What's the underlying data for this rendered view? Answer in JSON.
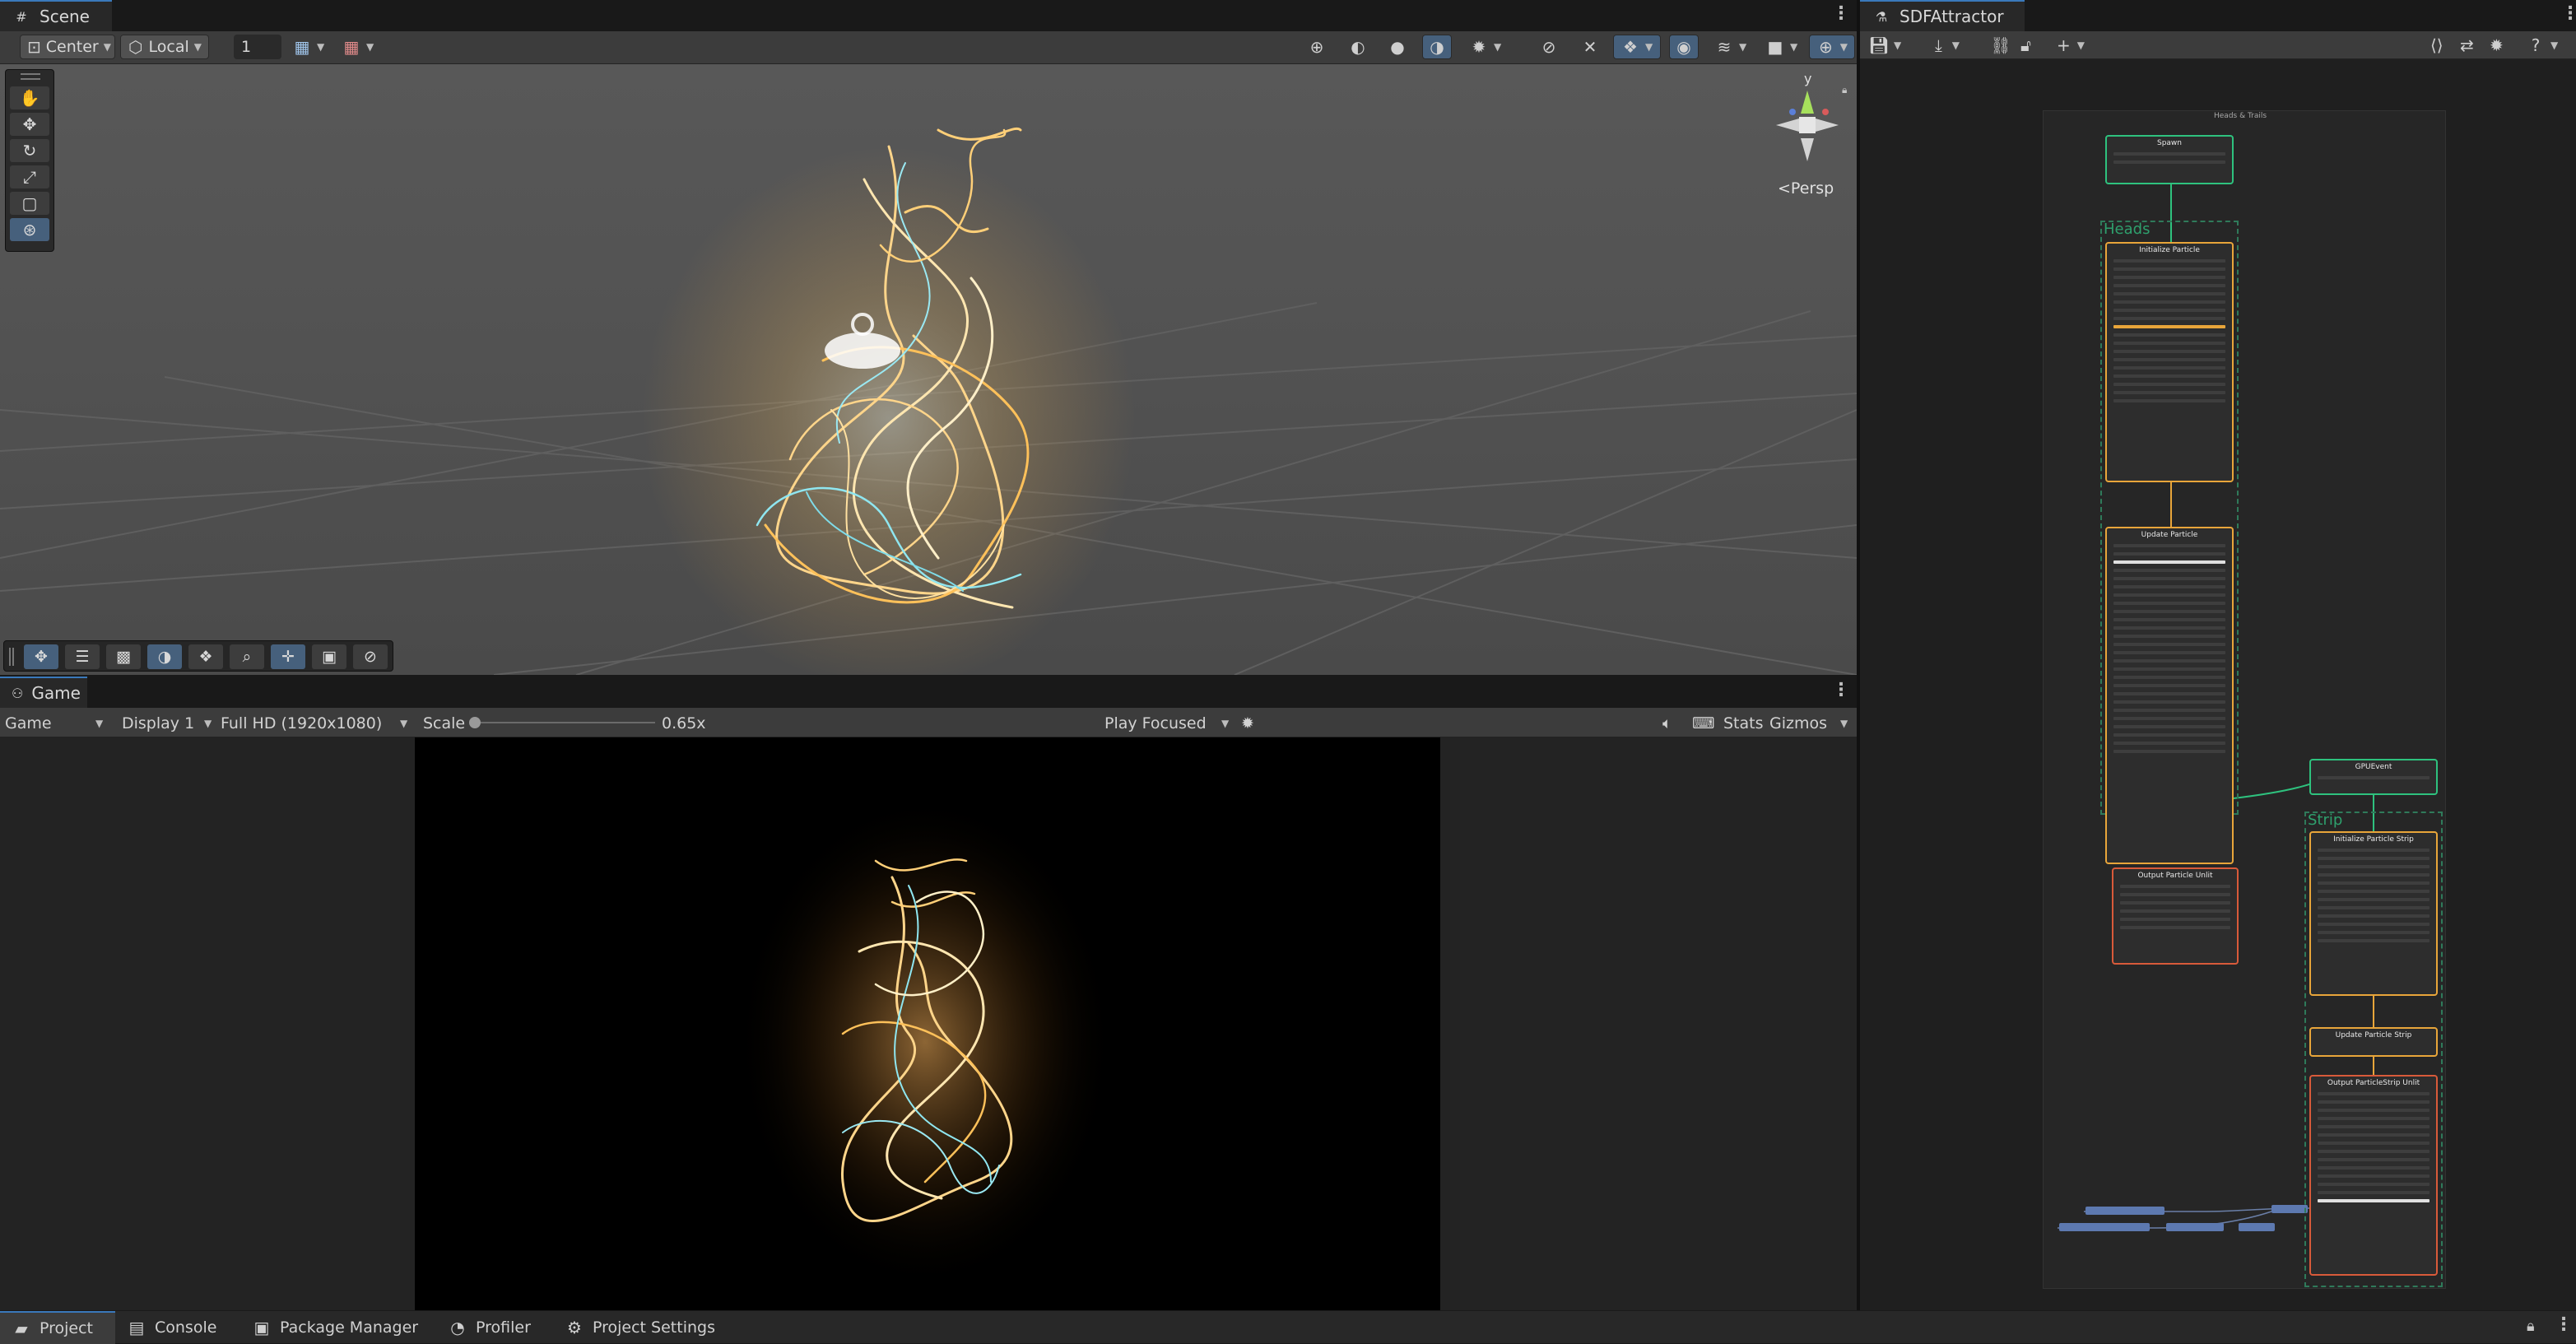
{
  "scene_panel": {
    "tab_label": "Scene",
    "toolbar": {
      "pivot_mode": "Center",
      "pivot_rotation": "Local",
      "grid_snap_value": "1"
    },
    "gizmo": {
      "axis_label": "y",
      "projection_label": "<Persp"
    }
  },
  "game_panel": {
    "tab_label": "Game",
    "toolbar": {
      "view_select": "Game",
      "display_select": "Display 1",
      "resolution_select": "Full HD (1920x1080)",
      "scale_label": "Scale",
      "scale_value": "0.65x",
      "play_mode_select": "Play Focused",
      "stats_label": "Stats",
      "gizmos_label": "Gizmos"
    }
  },
  "vfx_panel": {
    "tab_label": "SDFAttractor",
    "graph": {
      "system_title": "Heads & Trails",
      "heads_context_label": "Heads",
      "strip_context_label": "Strip",
      "spawn_node_title": "Spawn",
      "init_heads_title": "Initialize Particle",
      "update_heads_title": "Update Particle",
      "output_heads_title": "Output Particle Unlit",
      "gpu_event_title": "GPUEvent",
      "init_strip_title": "Initialize Particle Strip",
      "update_strip_title": "Update Particle Strip",
      "output_strip_title": "Output ParticleStrip Unlit"
    }
  },
  "bottom_tabs": [
    {
      "label": "Project",
      "active": true
    },
    {
      "label": "Console",
      "active": false
    },
    {
      "label": "Package Manager",
      "active": false
    },
    {
      "label": "Profiler",
      "active": false
    },
    {
      "label": "Project Settings",
      "active": false
    }
  ],
  "colors": {
    "accent_blue": "#3a79bb",
    "spawn_green": "#2ec27e",
    "context_orange": "#e8a53a",
    "output_red": "#d85a3a",
    "particle_glow": "#ffd58a",
    "particle_cyan": "#8fe6f0"
  }
}
